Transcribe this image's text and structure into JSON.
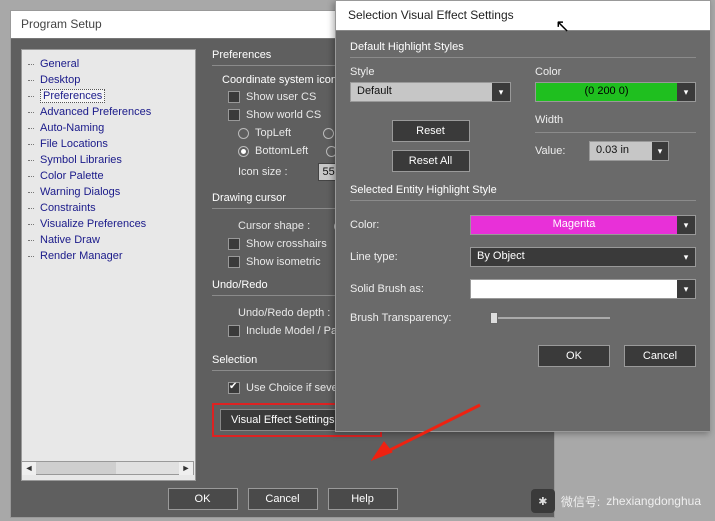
{
  "setup": {
    "title": "Program Setup",
    "tree": [
      "General",
      "Desktop",
      "Preferences",
      "Advanced Preferences",
      "Auto-Naming",
      "File Locations",
      "Symbol Libraries",
      "Color Palette",
      "Warning Dialogs",
      "Constraints",
      "Visualize Preferences",
      "Native Draw",
      "Render Manager"
    ],
    "selected_index": 2,
    "buttons": {
      "ok": "OK",
      "cancel": "Cancel",
      "help": "Help"
    }
  },
  "prefs": {
    "title": "Preferences",
    "coord_group": "Coordinate system icon",
    "show_user_cs": "Show user CS",
    "show_world_cs": "Show world CS",
    "topleft": "TopLeft",
    "bottomleft": "BottomLeft",
    "icon_size_label": "Icon size :",
    "icon_size_value": "55",
    "cursor_group": "Drawing cursor",
    "cursor_shape": "Cursor shape :",
    "show_crosshairs": "Show crosshairs",
    "show_isometric": "Show isometric",
    "undo_group": "Undo/Redo",
    "undo_depth": "Undo/Redo depth :",
    "include_model": "Include Model / Pape",
    "selection_group": "Selection",
    "use_choice": "Use Choice if sever",
    "ves_button": "Visual Effect Settings..."
  },
  "dialog": {
    "title": "Selection Visual Effect Settings",
    "group1": "Default Highlight Styles",
    "style_label": "Style",
    "style_value": "Default",
    "color_label": "Color",
    "color_value": "(0 200 0)",
    "width_label": "Width",
    "value_label": "Value:",
    "value_field": "0.03 in",
    "reset": "Reset",
    "reset_all": "Reset All",
    "group2": "Selected Entity Highlight Style",
    "sel_color_label": "Color:",
    "sel_color_value": "Magenta",
    "linetype_label": "Line type:",
    "linetype_value": "By Object",
    "solid_label": "Solid Brush as:",
    "brush_label": "Brush Transparency:",
    "ok": "OK",
    "cancel": "Cancel"
  },
  "watermark": {
    "label": "微信号:",
    "id": "zhexiangdonghua"
  }
}
